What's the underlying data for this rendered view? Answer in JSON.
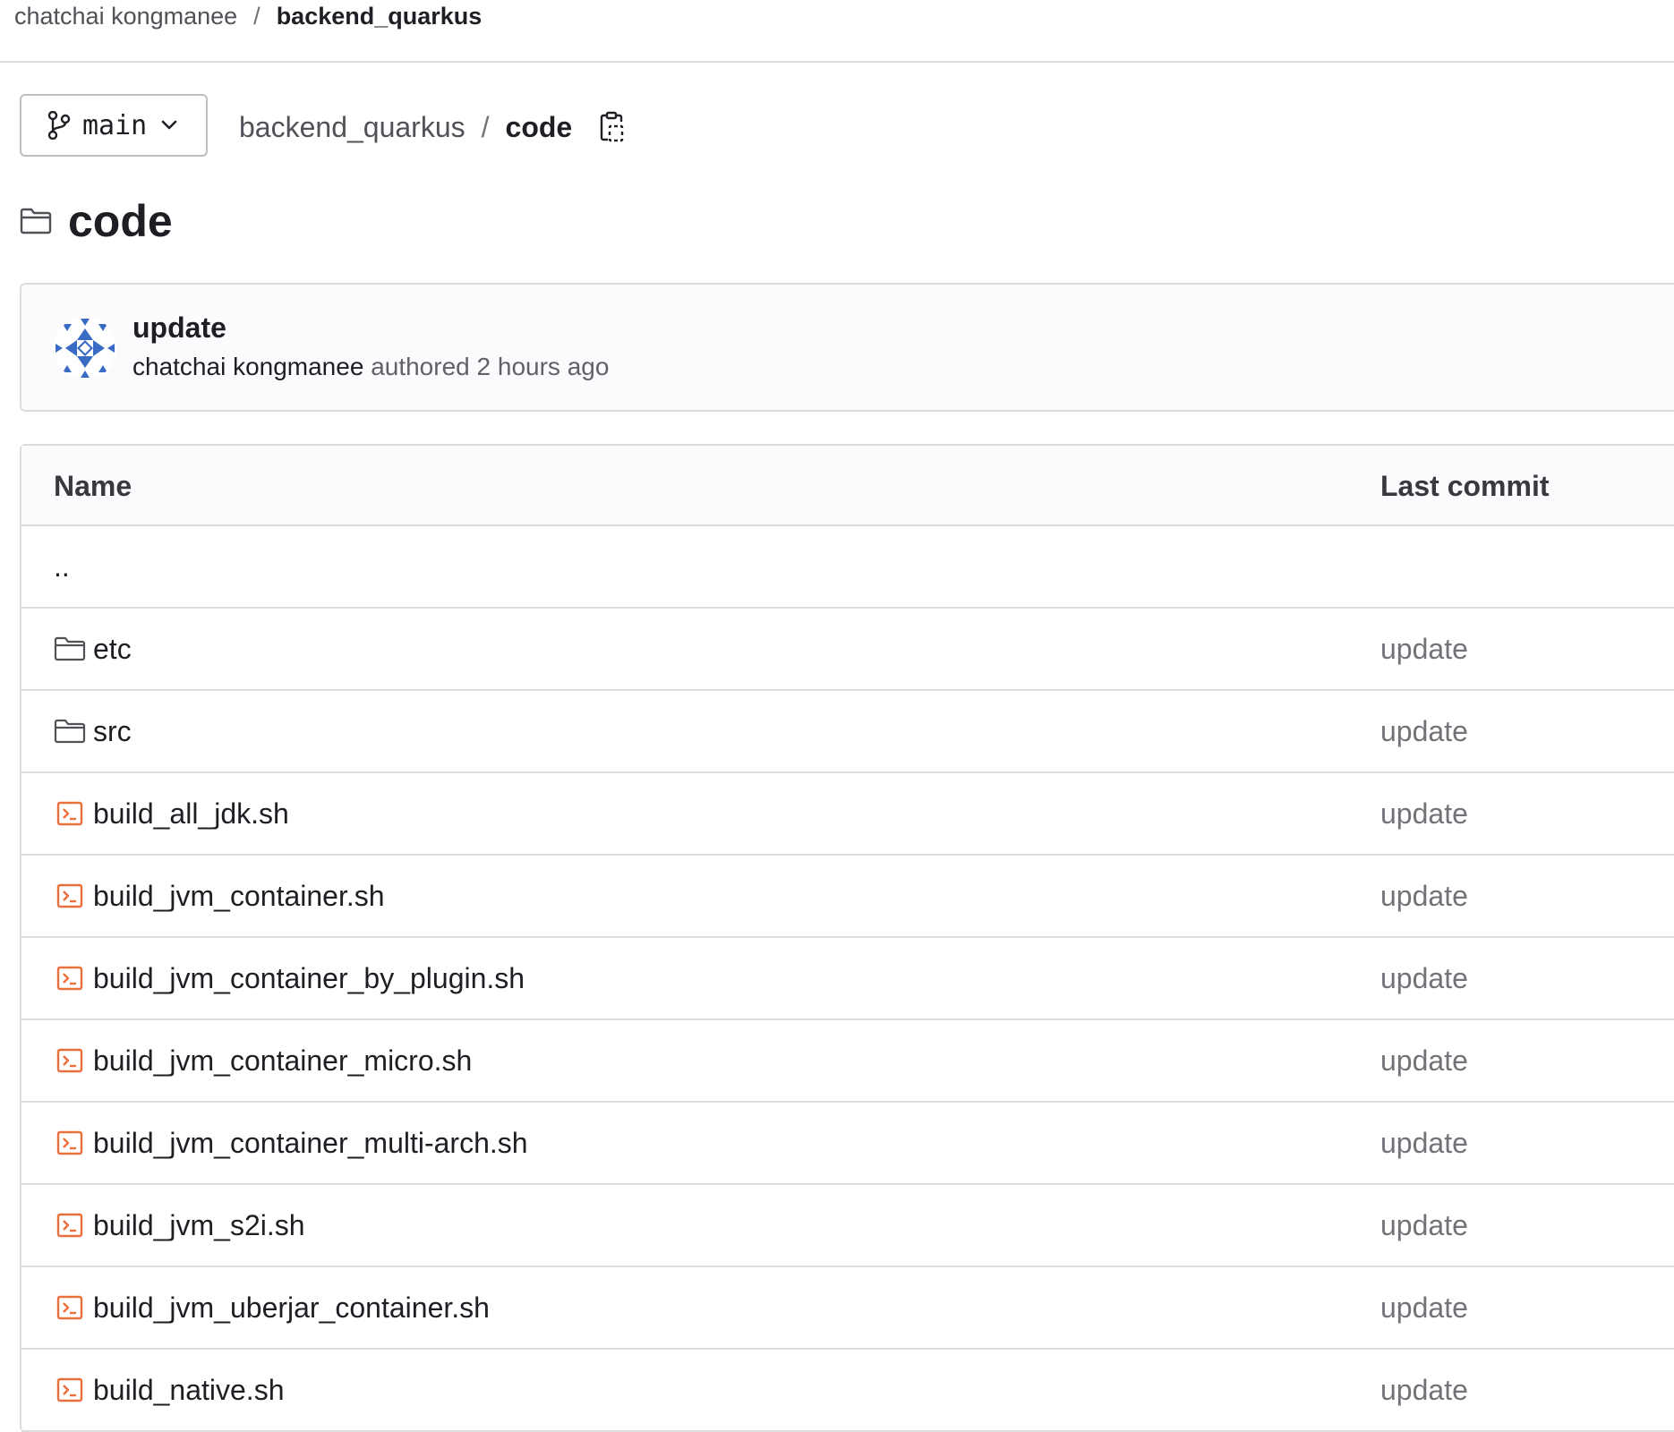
{
  "breadcrumb": {
    "owner": "chatchai kongmanee",
    "separator": "/",
    "project": "backend_quarkus"
  },
  "branch": {
    "name": "main",
    "icon": "branch-icon"
  },
  "path": {
    "repo": "backend_quarkus",
    "separator": "/",
    "current": "code",
    "copy_icon": "copy-icon"
  },
  "page_title": "code",
  "last_commit": {
    "title": "update",
    "author": "chatchai kongmanee",
    "authored_text": "authored",
    "time": "2 hours ago"
  },
  "table": {
    "headers": {
      "name": "Name",
      "last_commit": "Last commit"
    },
    "parent_link": "..",
    "rows": [
      {
        "name": "etc",
        "type": "folder",
        "commit": "update"
      },
      {
        "name": "src",
        "type": "folder",
        "commit": "update"
      },
      {
        "name": "build_all_jdk.sh",
        "type": "shell",
        "commit": "update"
      },
      {
        "name": "build_jvm_container.sh",
        "type": "shell",
        "commit": "update"
      },
      {
        "name": "build_jvm_container_by_plugin.sh",
        "type": "shell",
        "commit": "update"
      },
      {
        "name": "build_jvm_container_micro.sh",
        "type": "shell",
        "commit": "update"
      },
      {
        "name": "build_jvm_container_multi-arch.sh",
        "type": "shell",
        "commit": "update"
      },
      {
        "name": "build_jvm_s2i.sh",
        "type": "shell",
        "commit": "update"
      },
      {
        "name": "build_jvm_uberjar_container.sh",
        "type": "shell",
        "commit": "update"
      },
      {
        "name": "build_native.sh",
        "type": "shell",
        "commit": "update"
      }
    ]
  },
  "colors": {
    "text": "#1f1e24",
    "muted": "#737278",
    "border": "#dcdcde",
    "shell_icon": "#e9703c",
    "avatar_blue": "#3a6bc4"
  }
}
